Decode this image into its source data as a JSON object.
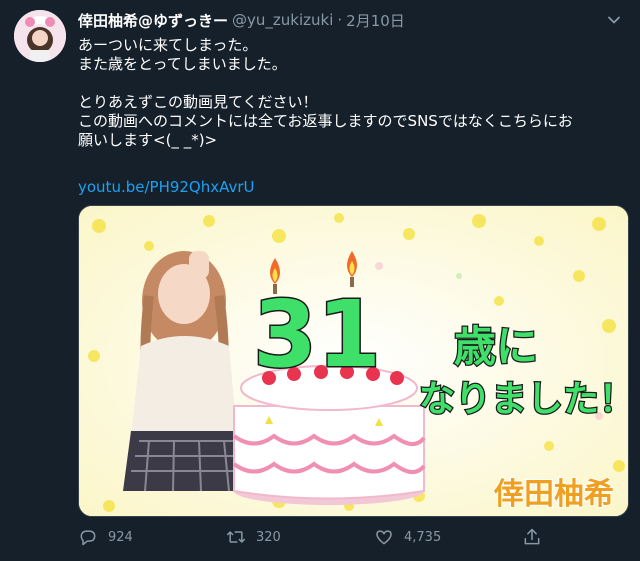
{
  "tweet": {
    "display_name": "倖田柚希@ゆずっきー",
    "handle": "@yu_zukizuki",
    "separator": "·",
    "date": "2月10日",
    "lines": [
      "あーついに来てしまった。",
      "また歳をとってしまいました。",
      "",
      "とりあえずこの動画見てください！",
      "この動画へのコメントには全てお返事しますのでSNSではなくこちらにお",
      "願いします<(_ _*)>"
    ],
    "link": "youtu.be/PH92QhxAvrU"
  },
  "card": {
    "number": "31",
    "headline_1": "歳に",
    "headline_2": "なりました！",
    "signature": "倖田柚希"
  },
  "actions": {
    "replies": "924",
    "retweets": "320",
    "likes": "4,735"
  },
  "colors": {
    "background": "#15202b",
    "text": "#ffffff",
    "muted": "#8899a6",
    "link": "#1da1f2",
    "headline_green": "#3ee06a",
    "signature_orange": "#f0a020"
  },
  "icons": {
    "more": "chevron-down-icon",
    "reply": "reply-icon",
    "retweet": "retweet-icon",
    "like": "heart-icon",
    "share": "share-icon"
  }
}
